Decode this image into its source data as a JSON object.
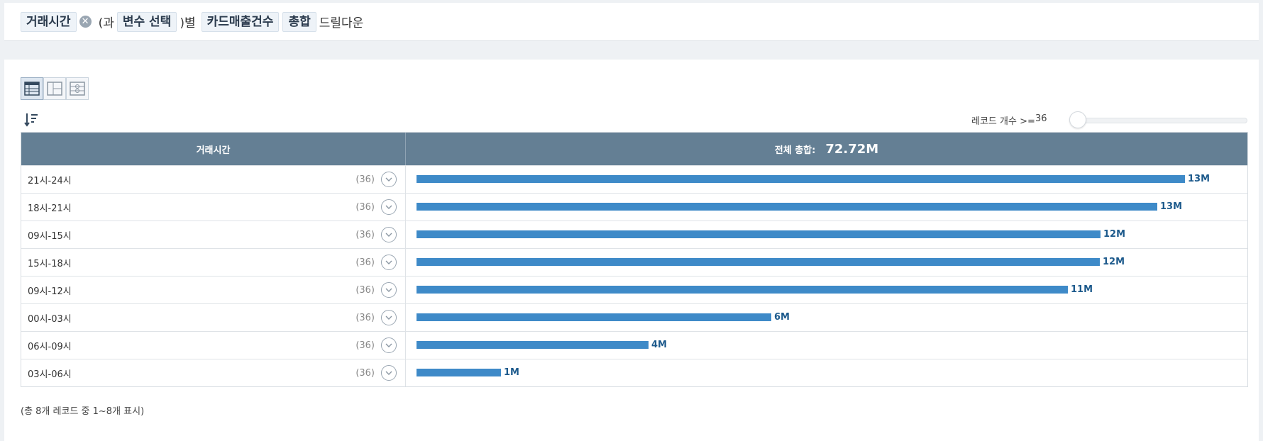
{
  "query_bar": {
    "field_chip": "거래시간",
    "connector_1": "(과",
    "variable_chip": "변수 선택",
    "connector_2": ")별",
    "measure_chip": "카드매출건수",
    "agg_chip": "총합",
    "suffix": "드릴다운"
  },
  "toolbar": {
    "record_count_label": "레코드 개수 >=",
    "record_count_value": "36"
  },
  "table": {
    "header_dimension": "거래시간",
    "header_total_label": "전체 총합:",
    "header_total_value": "72.72M",
    "rows": [
      {
        "label": "21시-24시",
        "count": "(36)",
        "value_label": "13M",
        "value": 13.2
      },
      {
        "label": "18시-21시",
        "count": "(36)",
        "value_label": "13M",
        "value": 12.73
      },
      {
        "label": "09시-15시",
        "count": "(36)",
        "value_label": "12M",
        "value": 11.75
      },
      {
        "label": "15시-18시",
        "count": "(36)",
        "value_label": "12M",
        "value": 11.74
      },
      {
        "label": "09시-12시",
        "count": "(36)",
        "value_label": "11M",
        "value": 11.19
      },
      {
        "label": "00시-03시",
        "count": "(36)",
        "value_label": "6M",
        "value": 6.1
      },
      {
        "label": "06시-09시",
        "count": "(36)",
        "value_label": "4M",
        "value": 3.99
      },
      {
        "label": "03시-06시",
        "count": "(36)",
        "value_label": "1M",
        "value": 1.45
      }
    ]
  },
  "footer": {
    "summary": "(총 8개 레코드 중 1~8개 표시)"
  }
}
